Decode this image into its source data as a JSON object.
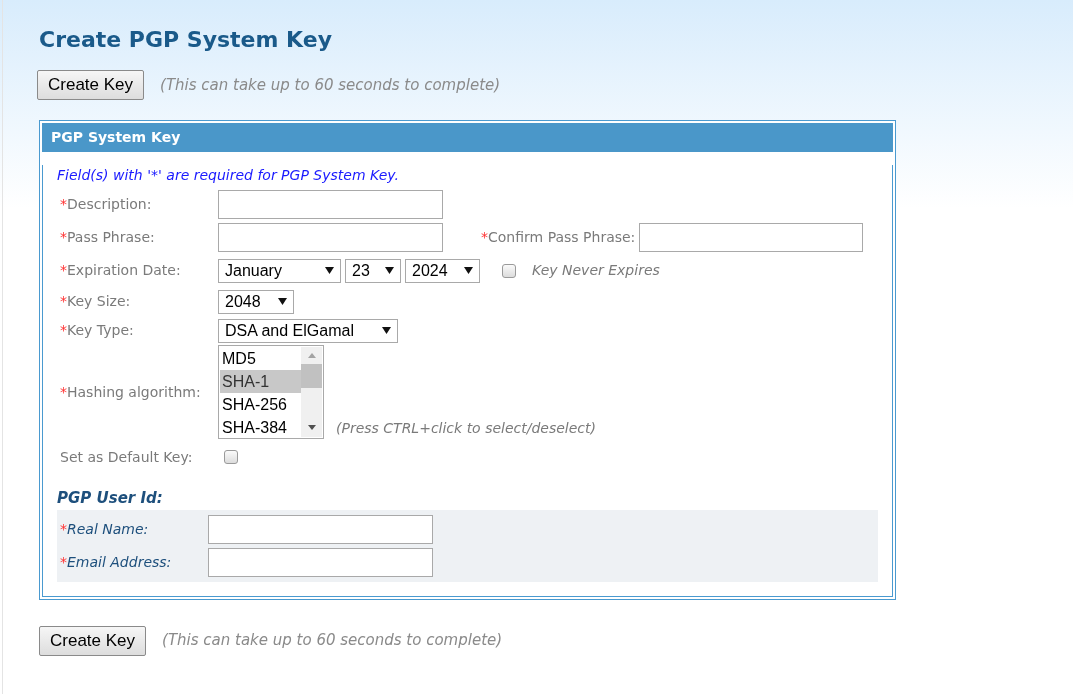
{
  "title": "Create PGP System Key",
  "top_action": {
    "button": "Create Key",
    "note": "(This can take up to 60 seconds to complete)"
  },
  "panel": {
    "title": "PGP System Key",
    "required_note": "Field(s) with '*' are required for PGP System Key.",
    "rows": [
      {
        "kind": "text",
        "mark": "*",
        "label": "Description:"
      },
      {
        "kind": "text",
        "mark": "*",
        "label": "Pass Phrase:",
        "second": {
          "mark": "*",
          "label": "Confirm Pass Phrase:"
        }
      },
      {
        "kind": "date",
        "mark": "*",
        "label": "Expiration Date:",
        "selects": [
          "January",
          "23",
          "2024"
        ],
        "checkbox": {
          "label": "Key Never Expires",
          "checked": false
        }
      },
      {
        "kind": "select",
        "mark": "*",
        "label": "Key Size:",
        "value": "2048"
      },
      {
        "kind": "select",
        "mark": "*",
        "label": "Key Type:",
        "value": "DSA and ElGamal"
      },
      {
        "kind": "listbox",
        "mark": "*",
        "label": "Hashing algorithm:",
        "options": [
          {
            "label": "MD5",
            "selected": false
          },
          {
            "label": "SHA-1",
            "selected": true
          },
          {
            "label": "SHA-256",
            "selected": false
          },
          {
            "label": "SHA-384",
            "selected": false
          }
        ],
        "hint": "(Press CTRL+click to select/deselect)"
      },
      {
        "kind": "checkbox",
        "label": "Set as Default Key:",
        "checked": false
      }
    ],
    "user_id": {
      "heading": "PGP User Id:",
      "rows": [
        {
          "mark": "*",
          "label": "Real Name:"
        },
        {
          "mark": "*",
          "label": "Email Address:"
        }
      ]
    }
  },
  "bottom_action": {
    "button": "Create Key",
    "note": "(This can take up to 60 seconds to complete)"
  }
}
